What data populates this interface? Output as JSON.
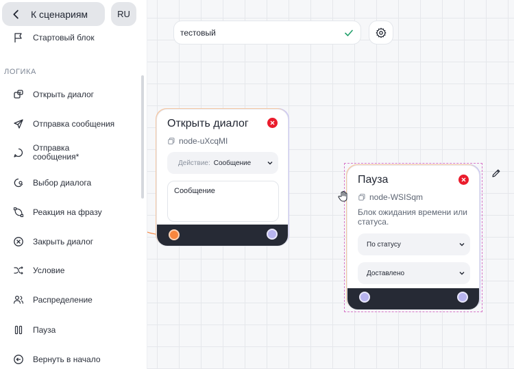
{
  "sidebar": {
    "back_label": "К сценариям",
    "lang": "RU",
    "start_block": "Стартовый блок",
    "section_logic": "ЛОГИКА",
    "items": [
      {
        "label": "Открыть диалог",
        "icon": "open-dialog-icon"
      },
      {
        "label": "Отправка сообщения",
        "icon": "send-icon"
      },
      {
        "label": "Отправка сообщения*",
        "icon": "chat-bubble-icon"
      },
      {
        "label": "Выбор диалога",
        "icon": "chat-search-icon"
      },
      {
        "label": "Реакция на фразу",
        "icon": "vector-path-icon"
      },
      {
        "label": "Закрыть диалог",
        "icon": "close-circle-icon"
      },
      {
        "label": "Условие",
        "icon": "shuffle-icon"
      },
      {
        "label": "Распределение",
        "icon": "users-icon"
      },
      {
        "label": "Пауза",
        "icon": "pause-icon"
      },
      {
        "label": "Вернуть в начало",
        "icon": "return-icon"
      }
    ]
  },
  "toolbar": {
    "name_value": "тестовый"
  },
  "node_open_dialog": {
    "title": "Открыть диалог",
    "id": "node-uXcqMI",
    "action_label": "Действие:",
    "action_value": "Сообщение",
    "message_text": "Сообщение"
  },
  "node_pause": {
    "title": "Пауза",
    "id": "node-WSISqm",
    "description": "Блок ожидания времени или статуса.",
    "mode_value": "По статусу",
    "status_value": "Доставлено"
  },
  "colors": {
    "accent_orange": "#f7863e",
    "accent_purple": "#b8b4f0",
    "danger": "#ea1c2c",
    "success": "#22a06b",
    "selection": "#d776c8"
  }
}
